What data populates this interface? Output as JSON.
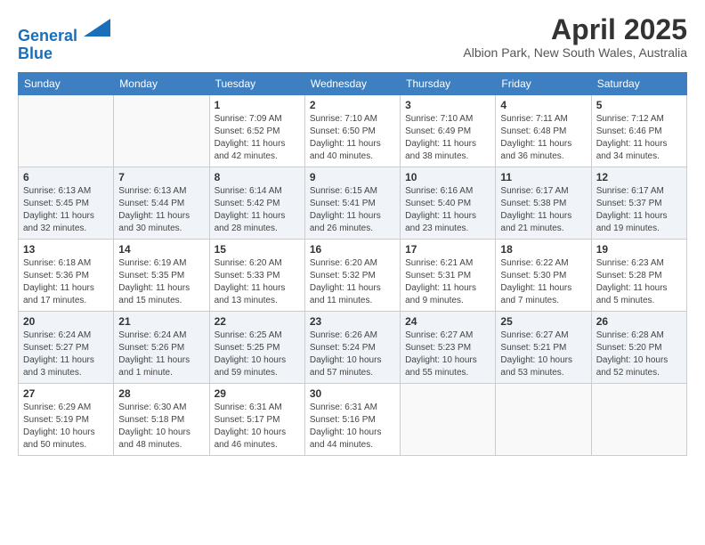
{
  "header": {
    "logo_line1": "General",
    "logo_line2": "Blue",
    "month_year": "April 2025",
    "location": "Albion Park, New South Wales, Australia"
  },
  "days_of_week": [
    "Sunday",
    "Monday",
    "Tuesday",
    "Wednesday",
    "Thursday",
    "Friday",
    "Saturday"
  ],
  "weeks": [
    [
      {
        "day": "",
        "info": ""
      },
      {
        "day": "",
        "info": ""
      },
      {
        "day": "1",
        "info": "Sunrise: 7:09 AM\nSunset: 6:52 PM\nDaylight: 11 hours and 42 minutes."
      },
      {
        "day": "2",
        "info": "Sunrise: 7:10 AM\nSunset: 6:50 PM\nDaylight: 11 hours and 40 minutes."
      },
      {
        "day": "3",
        "info": "Sunrise: 7:10 AM\nSunset: 6:49 PM\nDaylight: 11 hours and 38 minutes."
      },
      {
        "day": "4",
        "info": "Sunrise: 7:11 AM\nSunset: 6:48 PM\nDaylight: 11 hours and 36 minutes."
      },
      {
        "day": "5",
        "info": "Sunrise: 7:12 AM\nSunset: 6:46 PM\nDaylight: 11 hours and 34 minutes."
      }
    ],
    [
      {
        "day": "6",
        "info": "Sunrise: 6:13 AM\nSunset: 5:45 PM\nDaylight: 11 hours and 32 minutes."
      },
      {
        "day": "7",
        "info": "Sunrise: 6:13 AM\nSunset: 5:44 PM\nDaylight: 11 hours and 30 minutes."
      },
      {
        "day": "8",
        "info": "Sunrise: 6:14 AM\nSunset: 5:42 PM\nDaylight: 11 hours and 28 minutes."
      },
      {
        "day": "9",
        "info": "Sunrise: 6:15 AM\nSunset: 5:41 PM\nDaylight: 11 hours and 26 minutes."
      },
      {
        "day": "10",
        "info": "Sunrise: 6:16 AM\nSunset: 5:40 PM\nDaylight: 11 hours and 23 minutes."
      },
      {
        "day": "11",
        "info": "Sunrise: 6:17 AM\nSunset: 5:38 PM\nDaylight: 11 hours and 21 minutes."
      },
      {
        "day": "12",
        "info": "Sunrise: 6:17 AM\nSunset: 5:37 PM\nDaylight: 11 hours and 19 minutes."
      }
    ],
    [
      {
        "day": "13",
        "info": "Sunrise: 6:18 AM\nSunset: 5:36 PM\nDaylight: 11 hours and 17 minutes."
      },
      {
        "day": "14",
        "info": "Sunrise: 6:19 AM\nSunset: 5:35 PM\nDaylight: 11 hours and 15 minutes."
      },
      {
        "day": "15",
        "info": "Sunrise: 6:20 AM\nSunset: 5:33 PM\nDaylight: 11 hours and 13 minutes."
      },
      {
        "day": "16",
        "info": "Sunrise: 6:20 AM\nSunset: 5:32 PM\nDaylight: 11 hours and 11 minutes."
      },
      {
        "day": "17",
        "info": "Sunrise: 6:21 AM\nSunset: 5:31 PM\nDaylight: 11 hours and 9 minutes."
      },
      {
        "day": "18",
        "info": "Sunrise: 6:22 AM\nSunset: 5:30 PM\nDaylight: 11 hours and 7 minutes."
      },
      {
        "day": "19",
        "info": "Sunrise: 6:23 AM\nSunset: 5:28 PM\nDaylight: 11 hours and 5 minutes."
      }
    ],
    [
      {
        "day": "20",
        "info": "Sunrise: 6:24 AM\nSunset: 5:27 PM\nDaylight: 11 hours and 3 minutes."
      },
      {
        "day": "21",
        "info": "Sunrise: 6:24 AM\nSunset: 5:26 PM\nDaylight: 11 hours and 1 minute."
      },
      {
        "day": "22",
        "info": "Sunrise: 6:25 AM\nSunset: 5:25 PM\nDaylight: 10 hours and 59 minutes."
      },
      {
        "day": "23",
        "info": "Sunrise: 6:26 AM\nSunset: 5:24 PM\nDaylight: 10 hours and 57 minutes."
      },
      {
        "day": "24",
        "info": "Sunrise: 6:27 AM\nSunset: 5:23 PM\nDaylight: 10 hours and 55 minutes."
      },
      {
        "day": "25",
        "info": "Sunrise: 6:27 AM\nSunset: 5:21 PM\nDaylight: 10 hours and 53 minutes."
      },
      {
        "day": "26",
        "info": "Sunrise: 6:28 AM\nSunset: 5:20 PM\nDaylight: 10 hours and 52 minutes."
      }
    ],
    [
      {
        "day": "27",
        "info": "Sunrise: 6:29 AM\nSunset: 5:19 PM\nDaylight: 10 hours and 50 minutes."
      },
      {
        "day": "28",
        "info": "Sunrise: 6:30 AM\nSunset: 5:18 PM\nDaylight: 10 hours and 48 minutes."
      },
      {
        "day": "29",
        "info": "Sunrise: 6:31 AM\nSunset: 5:17 PM\nDaylight: 10 hours and 46 minutes."
      },
      {
        "day": "30",
        "info": "Sunrise: 6:31 AM\nSunset: 5:16 PM\nDaylight: 10 hours and 44 minutes."
      },
      {
        "day": "",
        "info": ""
      },
      {
        "day": "",
        "info": ""
      },
      {
        "day": "",
        "info": ""
      }
    ]
  ]
}
